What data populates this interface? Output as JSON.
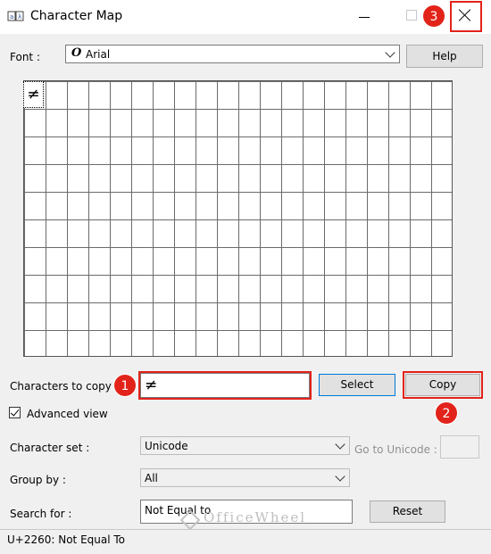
{
  "window": {
    "title": "Character Map",
    "icon": "charmap-app-icon"
  },
  "font_row": {
    "label": "Font :",
    "value": "Arial",
    "font_icon_glyph": "O",
    "help_label": "Help"
  },
  "grid": {
    "selected_char": "≠"
  },
  "copy_row": {
    "label": "Characters to copy :",
    "value": "≠",
    "select_label": "Select",
    "copy_label": "Copy"
  },
  "advanced": {
    "label": "Advanced view",
    "checked": true
  },
  "charset": {
    "label": "Character set :",
    "value": "Unicode",
    "goto_label": "Go to Unicode :"
  },
  "groupby": {
    "label": "Group by :",
    "value": "All"
  },
  "search": {
    "label": "Search for :",
    "value": "Not Equal to",
    "reset_label": "Reset"
  },
  "status": {
    "text": "U+2260: Not Equal To"
  },
  "annotations": {
    "badge1": "1",
    "badge2": "2",
    "badge3": "3",
    "color": "#e2231a"
  },
  "watermark": {
    "text": "OfficeWheel"
  }
}
